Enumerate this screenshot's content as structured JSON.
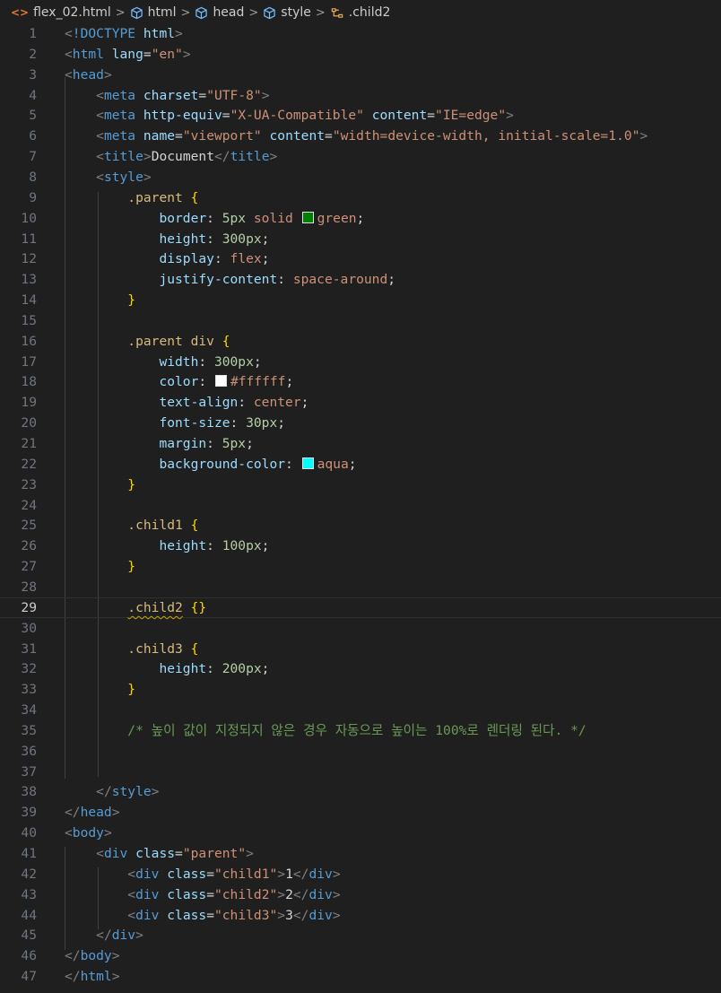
{
  "breadcrumb": {
    "file": "flex_02.html",
    "items": [
      "html",
      "head",
      "style",
      ".child2"
    ]
  },
  "colors": {
    "green": "#008000",
    "white": "#ffffff",
    "aqua": "#00ffff"
  },
  "editor": {
    "current_line": 29,
    "lines": [
      {
        "n": "1",
        "tokens": [
          [
            "t-br",
            "<"
          ],
          [
            "t-tag",
            "!DOCTYPE "
          ],
          [
            "t-attr",
            "html"
          ],
          [
            "t-br",
            ">"
          ]
        ]
      },
      {
        "n": "2",
        "tokens": [
          [
            "t-br",
            "<"
          ],
          [
            "t-tag",
            "html "
          ],
          [
            "t-attr",
            "lang"
          ],
          [
            "t-pun",
            "="
          ],
          [
            "t-str",
            "\"en\""
          ],
          [
            "t-br",
            ">"
          ]
        ]
      },
      {
        "n": "3",
        "tokens": [
          [
            "t-br",
            "<"
          ],
          [
            "t-tag",
            "head"
          ],
          [
            "t-br",
            ">"
          ]
        ]
      },
      {
        "n": "4",
        "tokens": [
          [
            "t-txt",
            "    "
          ],
          [
            "t-br",
            "<"
          ],
          [
            "t-tag",
            "meta "
          ],
          [
            "t-attr",
            "charset"
          ],
          [
            "t-pun",
            "="
          ],
          [
            "t-str",
            "\"UTF-8\""
          ],
          [
            "t-br",
            ">"
          ]
        ]
      },
      {
        "n": "5",
        "tokens": [
          [
            "t-txt",
            "    "
          ],
          [
            "t-br",
            "<"
          ],
          [
            "t-tag",
            "meta "
          ],
          [
            "t-attr",
            "http-equiv"
          ],
          [
            "t-pun",
            "="
          ],
          [
            "t-str",
            "\"X-UA-Compatible\""
          ],
          [
            "t-txt",
            " "
          ],
          [
            "t-attr",
            "content"
          ],
          [
            "t-pun",
            "="
          ],
          [
            "t-str",
            "\"IE=edge\""
          ],
          [
            "t-br",
            ">"
          ]
        ]
      },
      {
        "n": "6",
        "tokens": [
          [
            "t-txt",
            "    "
          ],
          [
            "t-br",
            "<"
          ],
          [
            "t-tag",
            "meta "
          ],
          [
            "t-attr",
            "name"
          ],
          [
            "t-pun",
            "="
          ],
          [
            "t-str",
            "\"viewport\""
          ],
          [
            "t-txt",
            " "
          ],
          [
            "t-attr",
            "content"
          ],
          [
            "t-pun",
            "="
          ],
          [
            "t-str",
            "\"width=device-width, initial-scale=1.0\""
          ],
          [
            "t-br",
            ">"
          ]
        ]
      },
      {
        "n": "7",
        "tokens": [
          [
            "t-txt",
            "    "
          ],
          [
            "t-br",
            "<"
          ],
          [
            "t-tag",
            "title"
          ],
          [
            "t-br",
            ">"
          ],
          [
            "t-txt",
            "Document"
          ],
          [
            "t-br",
            "</"
          ],
          [
            "t-tag",
            "title"
          ],
          [
            "t-br",
            ">"
          ]
        ]
      },
      {
        "n": "8",
        "tokens": [
          [
            "t-txt",
            "    "
          ],
          [
            "t-br",
            "<"
          ],
          [
            "t-tag",
            "style"
          ],
          [
            "t-br",
            ">"
          ]
        ]
      },
      {
        "n": "9",
        "tokens": [
          [
            "t-txt",
            "        "
          ],
          [
            "t-sel",
            ".parent "
          ],
          [
            "t-brace",
            "{"
          ]
        ]
      },
      {
        "n": "10",
        "tokens": [
          [
            "t-txt",
            "            "
          ],
          [
            "t-prop",
            "border"
          ],
          [
            "t-pun",
            ": "
          ],
          [
            "t-num",
            "5px"
          ],
          [
            "t-val",
            " solid "
          ],
          [
            "swatch",
            "green"
          ],
          [
            "t-val",
            "green"
          ],
          [
            "t-pun",
            ";"
          ]
        ]
      },
      {
        "n": "11",
        "tokens": [
          [
            "t-txt",
            "            "
          ],
          [
            "t-prop",
            "height"
          ],
          [
            "t-pun",
            ": "
          ],
          [
            "t-num",
            "300px"
          ],
          [
            "t-pun",
            ";"
          ]
        ]
      },
      {
        "n": "12",
        "tokens": [
          [
            "t-txt",
            "            "
          ],
          [
            "t-prop",
            "display"
          ],
          [
            "t-pun",
            ": "
          ],
          [
            "t-val",
            "flex"
          ],
          [
            "t-pun",
            ";"
          ]
        ]
      },
      {
        "n": "13",
        "tokens": [
          [
            "t-txt",
            "            "
          ],
          [
            "t-prop",
            "justify-content"
          ],
          [
            "t-pun",
            ": "
          ],
          [
            "t-val",
            "space-around"
          ],
          [
            "t-pun",
            ";"
          ]
        ]
      },
      {
        "n": "14",
        "tokens": [
          [
            "t-txt",
            "        "
          ],
          [
            "t-brace",
            "}"
          ]
        ]
      },
      {
        "n": "15",
        "tokens": []
      },
      {
        "n": "16",
        "tokens": [
          [
            "t-txt",
            "        "
          ],
          [
            "t-sel",
            ".parent div "
          ],
          [
            "t-brace",
            "{"
          ]
        ]
      },
      {
        "n": "17",
        "tokens": [
          [
            "t-txt",
            "            "
          ],
          [
            "t-prop",
            "width"
          ],
          [
            "t-pun",
            ": "
          ],
          [
            "t-num",
            "300px"
          ],
          [
            "t-pun",
            ";"
          ]
        ]
      },
      {
        "n": "18",
        "tokens": [
          [
            "t-txt",
            "            "
          ],
          [
            "t-prop",
            "color"
          ],
          [
            "t-pun",
            ": "
          ],
          [
            "swatch",
            "white"
          ],
          [
            "t-val",
            "#ffffff"
          ],
          [
            "t-pun",
            ";"
          ]
        ]
      },
      {
        "n": "19",
        "tokens": [
          [
            "t-txt",
            "            "
          ],
          [
            "t-prop",
            "text-align"
          ],
          [
            "t-pun",
            ": "
          ],
          [
            "t-val",
            "center"
          ],
          [
            "t-pun",
            ";"
          ]
        ]
      },
      {
        "n": "20",
        "tokens": [
          [
            "t-txt",
            "            "
          ],
          [
            "t-prop",
            "font-size"
          ],
          [
            "t-pun",
            ": "
          ],
          [
            "t-num",
            "30px"
          ],
          [
            "t-pun",
            ";"
          ]
        ]
      },
      {
        "n": "21",
        "tokens": [
          [
            "t-txt",
            "            "
          ],
          [
            "t-prop",
            "margin"
          ],
          [
            "t-pun",
            ": "
          ],
          [
            "t-num",
            "5px"
          ],
          [
            "t-pun",
            ";"
          ]
        ]
      },
      {
        "n": "22",
        "tokens": [
          [
            "t-txt",
            "            "
          ],
          [
            "t-prop",
            "background-color"
          ],
          [
            "t-pun",
            ": "
          ],
          [
            "swatch",
            "aqua"
          ],
          [
            "t-val",
            "aqua"
          ],
          [
            "t-pun",
            ";"
          ]
        ]
      },
      {
        "n": "23",
        "tokens": [
          [
            "t-txt",
            "        "
          ],
          [
            "t-brace",
            "}"
          ]
        ]
      },
      {
        "n": "24",
        "tokens": []
      },
      {
        "n": "25",
        "tokens": [
          [
            "t-txt",
            "        "
          ],
          [
            "t-sel",
            ".child1 "
          ],
          [
            "t-brace",
            "{"
          ]
        ]
      },
      {
        "n": "26",
        "tokens": [
          [
            "t-txt",
            "            "
          ],
          [
            "t-prop",
            "height"
          ],
          [
            "t-pun",
            ": "
          ],
          [
            "t-num",
            "100px"
          ],
          [
            "t-pun",
            ";"
          ]
        ]
      },
      {
        "n": "27",
        "tokens": [
          [
            "t-txt",
            "        "
          ],
          [
            "t-brace",
            "}"
          ]
        ]
      },
      {
        "n": "28",
        "tokens": []
      },
      {
        "n": "29",
        "tokens": [
          [
            "t-txt",
            "        "
          ],
          [
            "t-sel squiggle",
            ".child2"
          ],
          [
            "t-txt",
            " "
          ],
          [
            "t-brace",
            "{}"
          ]
        ]
      },
      {
        "n": "30",
        "tokens": []
      },
      {
        "n": "31",
        "tokens": [
          [
            "t-txt",
            "        "
          ],
          [
            "t-sel",
            ".child3 "
          ],
          [
            "t-brace",
            "{"
          ]
        ]
      },
      {
        "n": "32",
        "tokens": [
          [
            "t-txt",
            "            "
          ],
          [
            "t-prop",
            "height"
          ],
          [
            "t-pun",
            ": "
          ],
          [
            "t-num",
            "200px"
          ],
          [
            "t-pun",
            ";"
          ]
        ]
      },
      {
        "n": "33",
        "tokens": [
          [
            "t-txt",
            "        "
          ],
          [
            "t-brace",
            "}"
          ]
        ]
      },
      {
        "n": "34",
        "tokens": []
      },
      {
        "n": "35",
        "tokens": [
          [
            "t-txt",
            "        "
          ],
          [
            "t-cmt",
            "/* 높이 값이 지정되지 않은 경우 자동으로 높이는 100%로 렌더링 된다. */"
          ]
        ]
      },
      {
        "n": "36",
        "tokens": []
      },
      {
        "n": "37",
        "tokens": []
      },
      {
        "n": "38",
        "tokens": [
          [
            "t-txt",
            "    "
          ],
          [
            "t-br",
            "</"
          ],
          [
            "t-tag",
            "style"
          ],
          [
            "t-br",
            ">"
          ]
        ]
      },
      {
        "n": "39",
        "tokens": [
          [
            "t-br",
            "</"
          ],
          [
            "t-tag",
            "head"
          ],
          [
            "t-br",
            ">"
          ]
        ]
      },
      {
        "n": "40",
        "tokens": [
          [
            "t-br",
            "<"
          ],
          [
            "t-tag",
            "body"
          ],
          [
            "t-br",
            ">"
          ]
        ]
      },
      {
        "n": "41",
        "tokens": [
          [
            "t-txt",
            "    "
          ],
          [
            "t-br",
            "<"
          ],
          [
            "t-tag",
            "div "
          ],
          [
            "t-attr",
            "class"
          ],
          [
            "t-pun",
            "="
          ],
          [
            "t-str",
            "\"parent\""
          ],
          [
            "t-br",
            ">"
          ]
        ]
      },
      {
        "n": "42",
        "tokens": [
          [
            "t-txt",
            "        "
          ],
          [
            "t-br",
            "<"
          ],
          [
            "t-tag",
            "div "
          ],
          [
            "t-attr",
            "class"
          ],
          [
            "t-pun",
            "="
          ],
          [
            "t-str",
            "\"child1\""
          ],
          [
            "t-br",
            ">"
          ],
          [
            "t-txt",
            "1"
          ],
          [
            "t-br",
            "</"
          ],
          [
            "t-tag",
            "div"
          ],
          [
            "t-br",
            ">"
          ]
        ]
      },
      {
        "n": "43",
        "tokens": [
          [
            "t-txt",
            "        "
          ],
          [
            "t-br",
            "<"
          ],
          [
            "t-tag",
            "div "
          ],
          [
            "t-attr",
            "class"
          ],
          [
            "t-pun",
            "="
          ],
          [
            "t-str",
            "\"child2\""
          ],
          [
            "t-br",
            ">"
          ],
          [
            "t-txt",
            "2"
          ],
          [
            "t-br",
            "</"
          ],
          [
            "t-tag",
            "div"
          ],
          [
            "t-br",
            ">"
          ]
        ]
      },
      {
        "n": "44",
        "tokens": [
          [
            "t-txt",
            "        "
          ],
          [
            "t-br",
            "<"
          ],
          [
            "t-tag",
            "div "
          ],
          [
            "t-attr",
            "class"
          ],
          [
            "t-pun",
            "="
          ],
          [
            "t-str",
            "\"child3\""
          ],
          [
            "t-br",
            ">"
          ],
          [
            "t-txt",
            "3"
          ],
          [
            "t-br",
            "</"
          ],
          [
            "t-tag",
            "div"
          ],
          [
            "t-br",
            ">"
          ]
        ]
      },
      {
        "n": "45",
        "tokens": [
          [
            "t-txt",
            "    "
          ],
          [
            "t-br",
            "</"
          ],
          [
            "t-tag",
            "div"
          ],
          [
            "t-br",
            ">"
          ]
        ]
      },
      {
        "n": "46",
        "tokens": [
          [
            "t-br",
            "</"
          ],
          [
            "t-tag",
            "body"
          ],
          [
            "t-br",
            ">"
          ]
        ]
      },
      {
        "n": "47",
        "tokens": [
          [
            "t-br",
            "</"
          ],
          [
            "t-tag",
            "html"
          ],
          [
            "t-br",
            ">"
          ]
        ]
      }
    ]
  }
}
